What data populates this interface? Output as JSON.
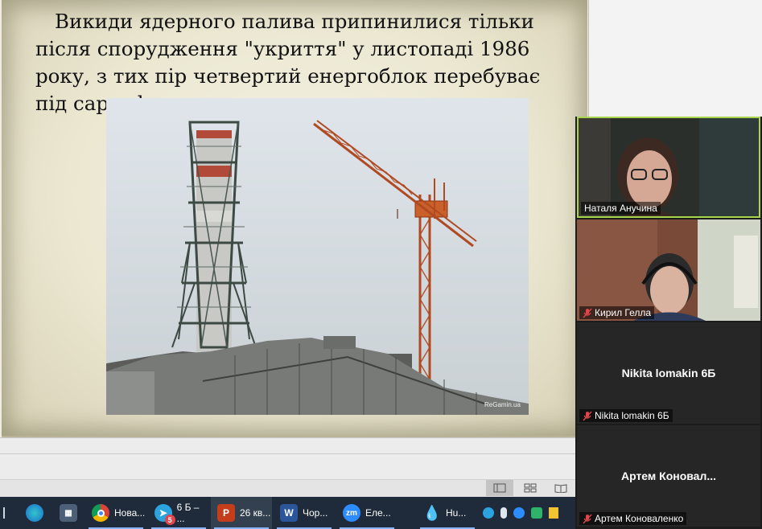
{
  "slide": {
    "text": "Викиди ядерного палива припинилися тільки після спорудження \"укриття\" у листопаді 1986 року, з тих пір четвертий енергоблок перебуває під саркофагом.",
    "photo_watermark": "ReGamin.ua"
  },
  "participants": [
    {
      "name": "Наталя Анучина",
      "muted": false,
      "video": true
    },
    {
      "name": "Кирил Гелла",
      "muted": true,
      "video": true
    },
    {
      "name": "Nikita lomakin 6Б",
      "display_name": "Nikita lomakin 6Б",
      "muted": true,
      "video": false
    },
    {
      "name": "Артем Коноваленко",
      "display_name": "Артем  Коновал...",
      "muted": true,
      "video": false
    }
  ],
  "taskbar": {
    "items": [
      {
        "label": "Нова...",
        "icon": "chrome-icon"
      },
      {
        "label": "6 Б – ...",
        "icon": "telegram-icon",
        "badge": "5"
      },
      {
        "label": "26 кв...",
        "icon": "powerpoint-icon",
        "active": true
      },
      {
        "label": "Чор...",
        "icon": "word-icon"
      },
      {
        "label": "Еле...",
        "icon": "zoom-icon"
      },
      {
        "label": "Hu...",
        "icon": "water-drop-icon"
      }
    ]
  },
  "colors": {
    "active_speaker": "#a9d54a",
    "taskbar_bg": "#1f2a3a",
    "muted": "#e0464b"
  }
}
